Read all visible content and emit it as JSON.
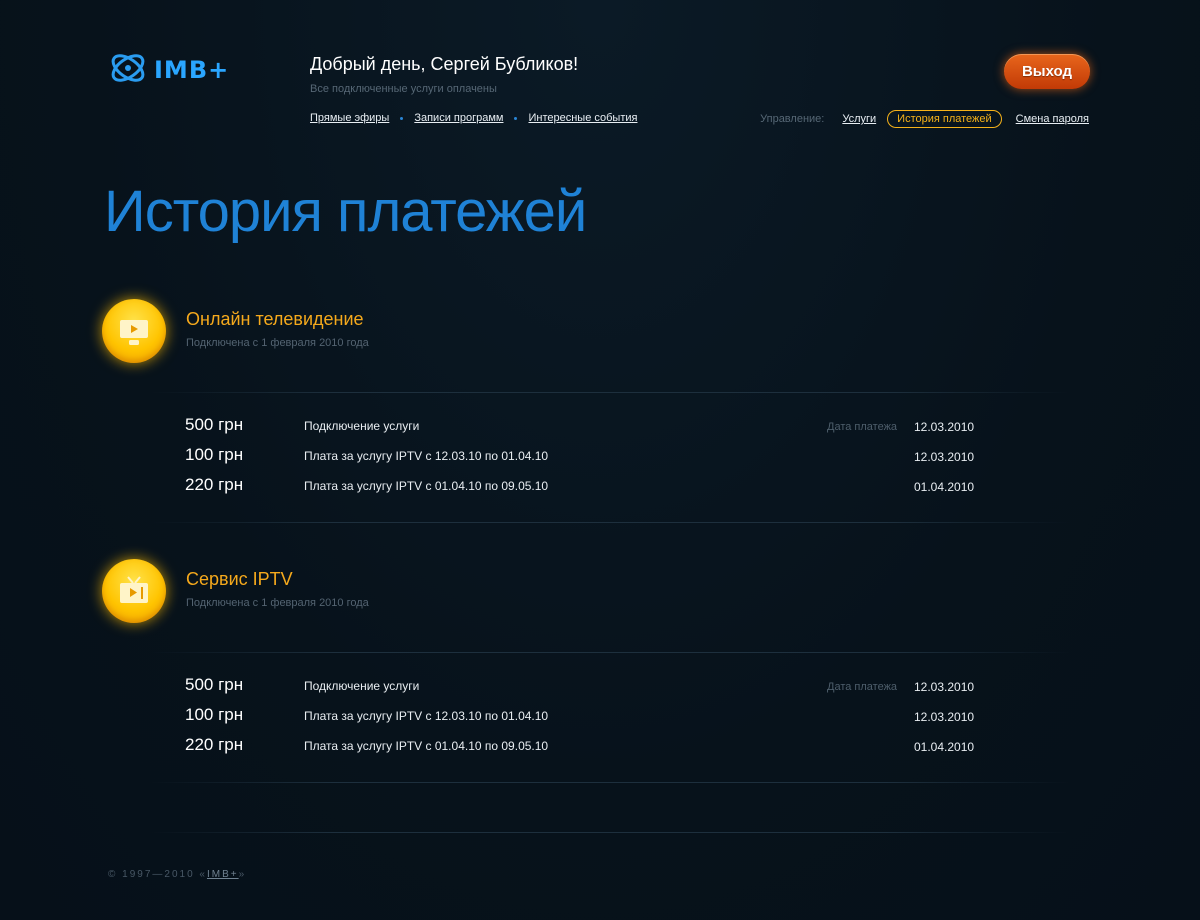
{
  "header": {
    "logo_text": "IMB+",
    "greeting": "Добрый день, Сергей Бубликов!",
    "subtitle": "Все подключенные услуги оплачены",
    "nav": [
      "Прямые эфиры",
      "Записи программ",
      "Интересные события"
    ],
    "management_label": "Управление:",
    "management_links": [
      "Услуги",
      "История платежей",
      "Смена пароля"
    ],
    "logout_label": "Выход",
    "accent_color": "#1f82d6",
    "highlight_color": "#f5a91c"
  },
  "page_title": "История платежей",
  "services": [
    {
      "icon": "monitor-icon",
      "name": "Онлайн телевидение",
      "subtitle": "Подключена с 1 февраля 2010 года",
      "payments": [
        {
          "amount": "500 грн",
          "description": "Подключение услуги",
          "date_label": "Дата платежа",
          "date": "12.03.2010"
        },
        {
          "amount": "100 грн",
          "description": "Плата за услугу IPTV с 12.03.10 по 01.04.10",
          "date": "12.03.2010"
        },
        {
          "amount": "220 грн",
          "description": "Плата за услугу IPTV с 01.04.10 по 09.05.10",
          "date": "01.04.2010"
        }
      ]
    },
    {
      "icon": "tv-icon",
      "name": "Сервис IPTV",
      "subtitle": "Подключена с 1 февраля 2010 года",
      "payments": [
        {
          "amount": "500 грн",
          "description": "Подключение услуги",
          "date_label": "Дата платежа",
          "date": "12.03.2010"
        },
        {
          "amount": "100 грн",
          "description": "Плата за услугу IPTV с 12.03.10 по 01.04.10",
          "date": "12.03.2010"
        },
        {
          "amount": "220 грн",
          "description": "Плата за услугу IPTV с 01.04.10 по 09.05.10",
          "date": "01.04.2010"
        }
      ]
    }
  ],
  "footer": {
    "copyright": "© 1997—2010 «",
    "link": "IMB+",
    "suffix": "»"
  }
}
